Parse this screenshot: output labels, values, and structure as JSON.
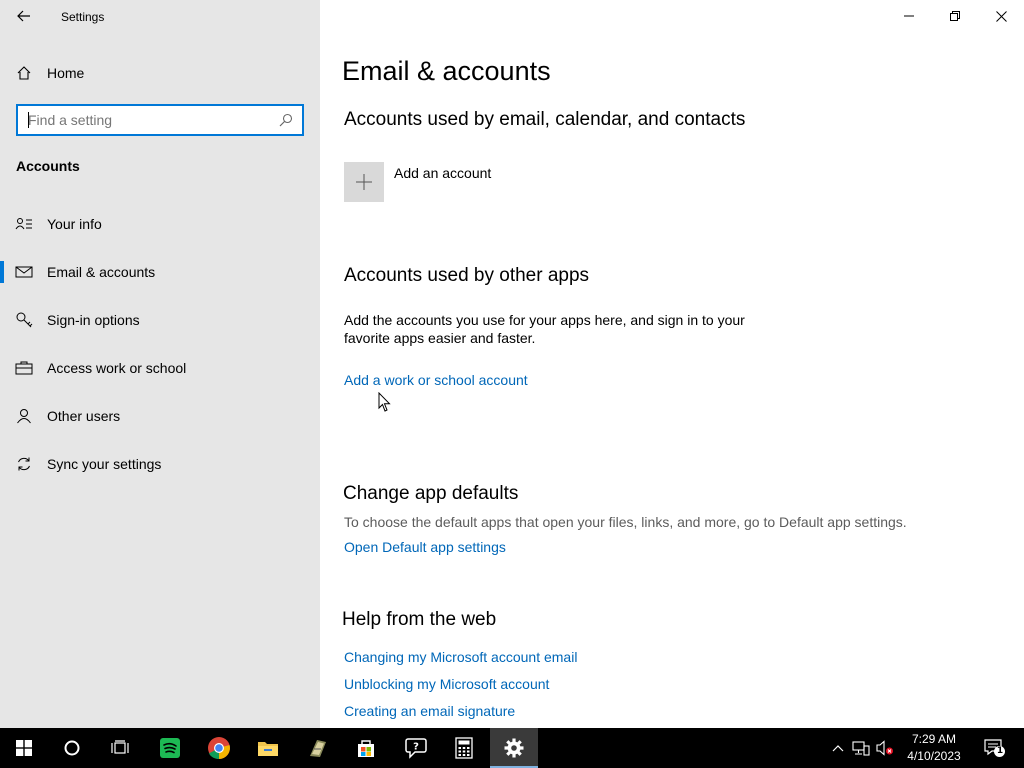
{
  "window": {
    "title": "Settings"
  },
  "sidebar": {
    "home_label": "Home",
    "search_placeholder": "Find a setting",
    "section_label": "Accounts",
    "items": [
      {
        "label": "Your info",
        "icon": "person-card-icon"
      },
      {
        "label": "Email & accounts",
        "icon": "mail-icon",
        "active": true
      },
      {
        "label": "Sign-in options",
        "icon": "key-icon"
      },
      {
        "label": "Access work or school",
        "icon": "briefcase-icon"
      },
      {
        "label": "Other users",
        "icon": "person-icon"
      },
      {
        "label": "Sync your settings",
        "icon": "sync-icon"
      }
    ]
  },
  "main": {
    "page_title": "Email & accounts",
    "email_section": {
      "heading": "Accounts used by email, calendar, and contacts",
      "add_account_label": "Add an account"
    },
    "other_apps_section": {
      "heading": "Accounts used by other apps",
      "description": "Add the accounts you use for your apps here, and sign in to your favorite apps easier and faster.",
      "link": "Add a work or school account"
    },
    "defaults_section": {
      "heading": "Change app defaults",
      "description": "To choose the default apps that open your files, links, and more, go to Default app settings.",
      "link": "Open Default app settings"
    },
    "help_section": {
      "heading": "Help from the web",
      "links": [
        "Changing my Microsoft account email",
        "Unblocking my Microsoft account",
        "Creating an email signature"
      ]
    }
  },
  "taskbar": {
    "time": "7:29 AM",
    "date": "4/10/2023",
    "notification_count": "1",
    "apps": [
      "start",
      "cortana",
      "task-view",
      "spotify",
      "chrome",
      "file-explorer",
      "app",
      "store",
      "help",
      "calculator",
      "settings"
    ]
  },
  "colors": {
    "accent": "#0078d7",
    "link": "#0067b8",
    "sidebar_bg": "#e6e6e6",
    "taskbar_bg": "#000000"
  }
}
